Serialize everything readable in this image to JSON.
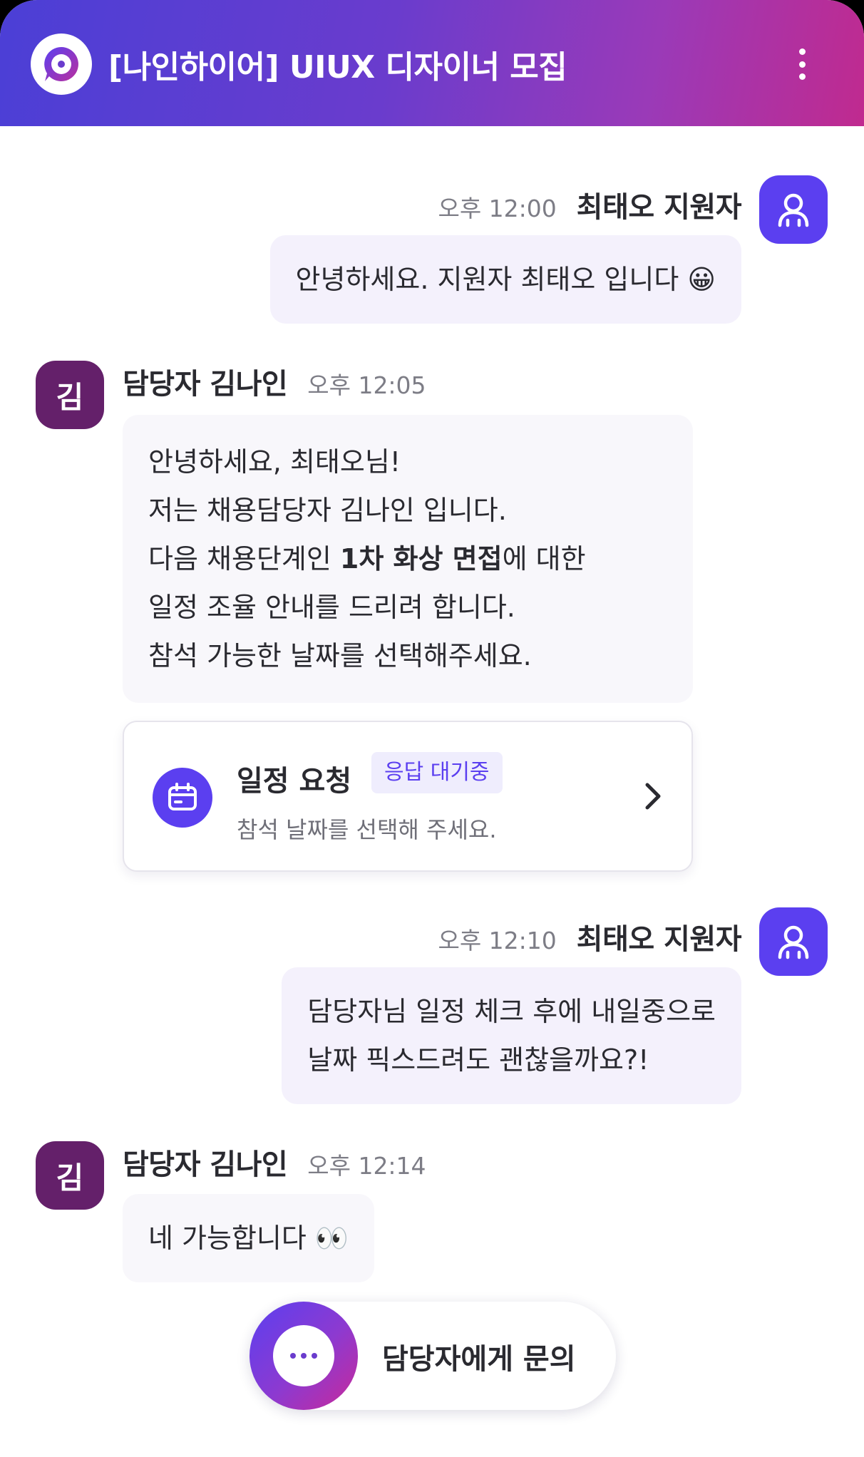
{
  "header": {
    "title": "[나인하이어] UIUX 디자이너 모집",
    "logo_icon": "chat-bubble-logo-icon",
    "more_icon": "more-vertical-icon"
  },
  "colors": {
    "brand": "#5b3ff0",
    "staff_avatar": "#64206a",
    "gradient_start": "#4b3fd6",
    "gradient_end": "#c02a8f"
  },
  "messages": [
    {
      "side": "right",
      "time": "오후 12:00",
      "sender": "최태오 지원자",
      "lines": [
        "안녕하세요. 지원자 최태오 입니다 😀"
      ]
    },
    {
      "side": "left",
      "avatar": "김",
      "sender": "담당자 김나인",
      "time": "오후 12:05",
      "lines": [
        "안녕하세요, 최태오님!",
        "저는 채용담당자 김나인 입니다.",
        "다음 채용단계인 ",
        "일정 조율 안내를 드리려 합니다.",
        "참석 가능한 날짜를 선택해주세요."
      ],
      "bold_segment": "1차 화상 면접",
      "after_bold": "에 대한"
    },
    {
      "side": "right",
      "time": "오후 12:10",
      "sender": "최태오 지원자",
      "lines": [
        "담당자님 일정 체크 후에 내일중으로",
        "날짜 픽스드려도 괜찮을까요?!"
      ]
    },
    {
      "side": "left",
      "avatar": "김",
      "sender": "담당자 김나인",
      "time": "오후 12:14",
      "lines": [
        "네 가능합니다 👀"
      ]
    }
  ],
  "schedule_card": {
    "title": "일정 요청",
    "badge": "응답 대기중",
    "subtitle": "참석 날짜를 선택해 주세요.",
    "icon": "calendar-icon",
    "chevron": "chevron-right-icon"
  },
  "inquiry_button": {
    "label": "담당자에게 문의",
    "icon": "chat-dots-icon"
  }
}
